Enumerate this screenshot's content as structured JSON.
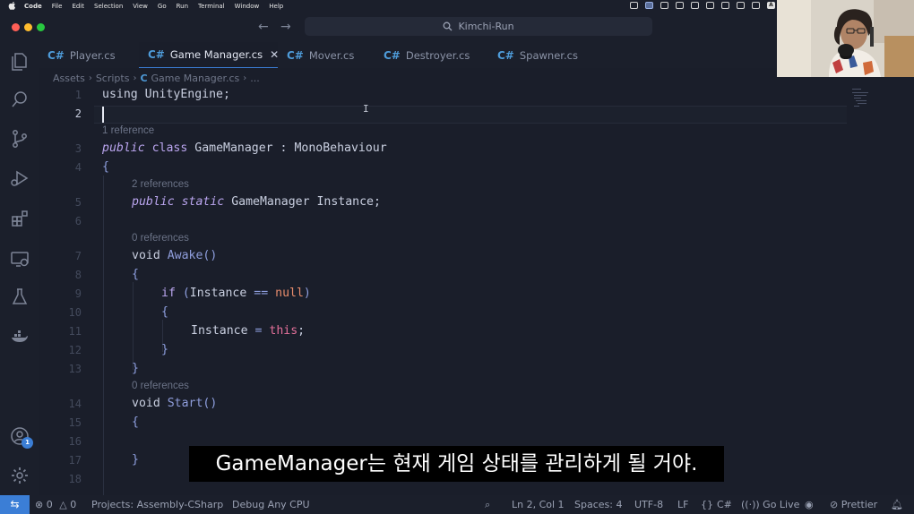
{
  "menubar": {
    "items": [
      "Code",
      "File",
      "Edit",
      "Selection",
      "View",
      "Go",
      "Run",
      "Terminal",
      "Window",
      "Help"
    ],
    "tray_letter": "A"
  },
  "titlebar": {
    "search_text": "Kimchi-Run"
  },
  "tabs": [
    {
      "icon": "C#",
      "label": "Player.cs",
      "active": false
    },
    {
      "icon": "C#",
      "label": "Game Manager.cs",
      "active": true
    },
    {
      "icon": "C#",
      "label": "Mover.cs",
      "active": false
    },
    {
      "icon": "C#",
      "label": "Destroyer.cs",
      "active": false
    },
    {
      "icon": "C#",
      "label": "Spawner.cs",
      "active": false
    }
  ],
  "breadcrumb": {
    "parts": [
      "Assets",
      "Scripts",
      "Game Manager.cs",
      "..."
    ]
  },
  "editor": {
    "line_numbers": [
      "1",
      "2",
      "3",
      "4",
      "5",
      "6",
      "7",
      "8",
      "9",
      "10",
      "11",
      "12",
      "13",
      "14",
      "15",
      "16",
      "17",
      "18"
    ],
    "lens": {
      "l3": "1 reference",
      "l5": "2 references",
      "l7": "0 references",
      "l14": "0 references"
    },
    "tokens": {
      "using": "using",
      "unity_engine": "UnityEngine;",
      "public": "public",
      "class": "class",
      "game_manager": "GameManager",
      "colon": ":",
      "mono": "MonoBehaviour",
      "lbrace": "{",
      "rbrace": "}",
      "static": "static",
      "instance_decl": "GameManager Instance;",
      "void": "void",
      "awake": "Awake",
      "start": "Start",
      "parens": "()",
      "if": "if",
      "lparen": "(",
      "instance": "Instance",
      "eqeq": "==",
      "null": "null",
      "rparen": ")",
      "assign": "=",
      "this": "this",
      "semi": ";"
    }
  },
  "subtitle": "GameManager는 현재 게임 상태를 관리하게 될 거야.",
  "activity": {
    "account_badge": "1"
  },
  "statusbar": {
    "errors": "0",
    "warnings": "0",
    "projects": "Projects: Assembly-CSharp",
    "debug": "Debug Any CPU",
    "position": "Ln 2, Col 1",
    "spaces": "Spaces: 4",
    "encoding": "UTF-8",
    "eol": "LF",
    "language": "C#",
    "go_live": "Go Live",
    "prettier": "Prettier"
  },
  "colors": {
    "accent": "#3b7ed6",
    "background": "#1a1e2a",
    "keyword_purple": "#bba6f0",
    "function_blue": "#8f9ddb",
    "null_orange": "#e88c6c",
    "this_pink": "#e3709a"
  }
}
